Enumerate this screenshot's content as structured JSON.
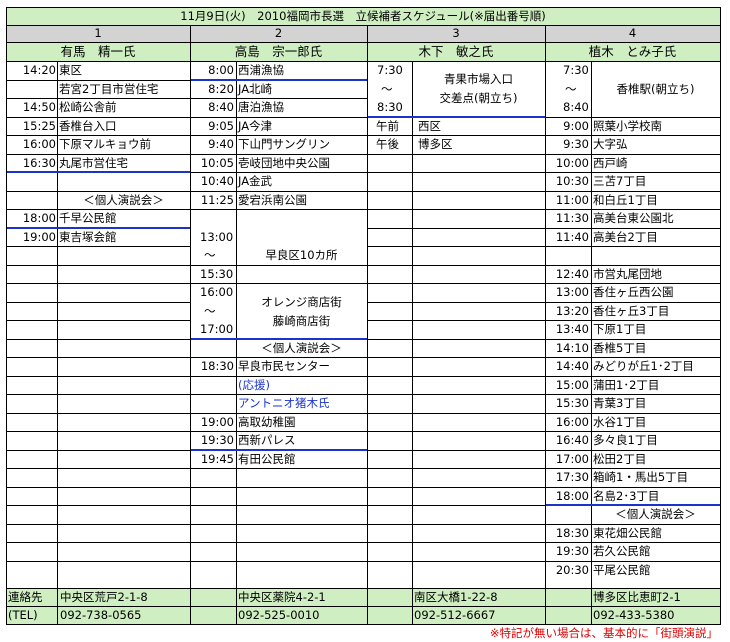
{
  "title": "11月9日(火)　2010福岡市長選　立候補者スケジュール(※届出番号順)",
  "candidates": [
    {
      "number": "1",
      "name": "有馬　精一氏"
    },
    {
      "number": "2",
      "name": "高島　宗一郎氏"
    },
    {
      "number": "3",
      "name": "木下　敏之氏"
    },
    {
      "number": "4",
      "name": "植木　とみ子氏"
    }
  ],
  "c1": [
    {
      "time": "14:20",
      "place": "東区"
    },
    {
      "time": "",
      "place": "若宮2丁目市営住宅"
    },
    {
      "time": "14:50",
      "place": "松崎公舎前"
    },
    {
      "time": "15:25",
      "place": "香椎台入口"
    },
    {
      "time": "16:00",
      "place": "下原マルキョウ前"
    },
    {
      "time": "16:30",
      "place": "丸尾市営住宅"
    },
    {
      "time": "",
      "place": "＜個人演説会＞"
    },
    {
      "time": "18:00",
      "place": "千早公民館"
    },
    {
      "time": "19:00",
      "place": "東吉塚会館"
    }
  ],
  "c2": [
    {
      "time": "8:00",
      "place": "西浦漁協"
    },
    {
      "time": "8:20",
      "place": "JA北崎"
    },
    {
      "time": "8:40",
      "place": "唐泊漁協"
    },
    {
      "time": "9:05",
      "place": "JA今津"
    },
    {
      "time": "9:40",
      "place": "下山門サングリン"
    },
    {
      "time": "10:05",
      "place": "壱岐団地中央公園"
    },
    {
      "time": "10:40",
      "place": "JA金武"
    },
    {
      "time": "11:25",
      "place": "愛宕浜南公園"
    }
  ],
  "c2_block1": {
    "from": "13:00",
    "sep": "～",
    "to": "15:30",
    "place": "早良区10カ所"
  },
  "c2_block2": {
    "from": "16:00",
    "sep": "～",
    "to": "17:00",
    "place_1": "オレンジ商店街",
    "place_2": "藤崎商店街"
  },
  "c2_rally": {
    "label": "＜個人演説会＞",
    "time": "18:30",
    "place": "早良市民センター",
    "support_1": "(応援)",
    "support_2": "アントニオ猪木氏"
  },
  "c2_tail": [
    {
      "time": "19:00",
      "place": "高取幼稚園"
    },
    {
      "time": "19:30",
      "place": "西新パレス"
    },
    {
      "time": "19:45",
      "place": "有田公民館"
    }
  ],
  "c3_block": {
    "from": "7:30",
    "sep": "～",
    "to": "8:30",
    "place_1": "青果市場入口",
    "place_2": "交差点(朝立ち)"
  },
  "c3_rows": [
    {
      "time": "午前",
      "place": "西区"
    },
    {
      "time": "午後",
      "place": "博多区"
    }
  ],
  "c4_block": {
    "from": "7:30",
    "sep": "～",
    "to": "8:40",
    "place": "香椎駅(朝立ち)"
  },
  "c4_a": [
    {
      "time": "9:00",
      "place": "照葉小学校南"
    },
    {
      "time": "9:30",
      "place": "大字弘"
    },
    {
      "time": "10:00",
      "place": "西戸崎"
    },
    {
      "time": "10:30",
      "place": "三苫7丁目"
    },
    {
      "time": "11:00",
      "place": "和白丘1丁目"
    },
    {
      "time": "11:30",
      "place": "高美台東公園北"
    },
    {
      "time": "11:40",
      "place": "高美台2丁目"
    }
  ],
  "c4_b": [
    {
      "time": "12:40",
      "place": "市営丸尾団地"
    },
    {
      "time": "13:00",
      "place": "香住ヶ丘西公園"
    },
    {
      "time": "13:20",
      "place": "香住ヶ丘3丁目"
    },
    {
      "time": "13:40",
      "place": "下原1丁目"
    },
    {
      "time": "14:10",
      "place": "香椎5丁目"
    },
    {
      "time": "14:40",
      "place": "みどりが丘1･2丁目"
    },
    {
      "time": "15:00",
      "place": "蒲田1･2丁目"
    },
    {
      "time": "15:30",
      "place": "青葉3丁目"
    },
    {
      "time": "16:00",
      "place": "水谷1丁目"
    },
    {
      "time": "16:40",
      "place": "多々良1丁目"
    },
    {
      "time": "17:00",
      "place": "松田2丁目"
    },
    {
      "time": "17:30",
      "place": "箱崎1・馬出5丁目"
    },
    {
      "time": "18:00",
      "place": "名島2･3丁目"
    }
  ],
  "c4_rally": {
    "label": "＜個人演説会＞",
    "rows": [
      {
        "time": "18:30",
        "place": "東花畑公民館"
      },
      {
        "time": "19:30",
        "place": "若久公民館"
      },
      {
        "time": "20:30",
        "place": "平尾公民館"
      }
    ]
  },
  "contact": {
    "label_1": "連絡先",
    "label_2": "(TEL)",
    "addresses": [
      "中央区荒戸2-1-8",
      "中央区薬院4-2-1",
      "南区大橋1-22-8",
      "博多区比恵町2-1"
    ],
    "phones": [
      "092-738-0565",
      "092-525-0010",
      "092-512-6667",
      "092-433-5380"
    ]
  },
  "note": "※特記が無い場合は、基本的に「街頭演説」",
  "colors": {
    "header_bg": "#cfeec2",
    "number_bg": "#d3d3d3",
    "accent_line": "#1a33cc",
    "note": "#e00000"
  }
}
